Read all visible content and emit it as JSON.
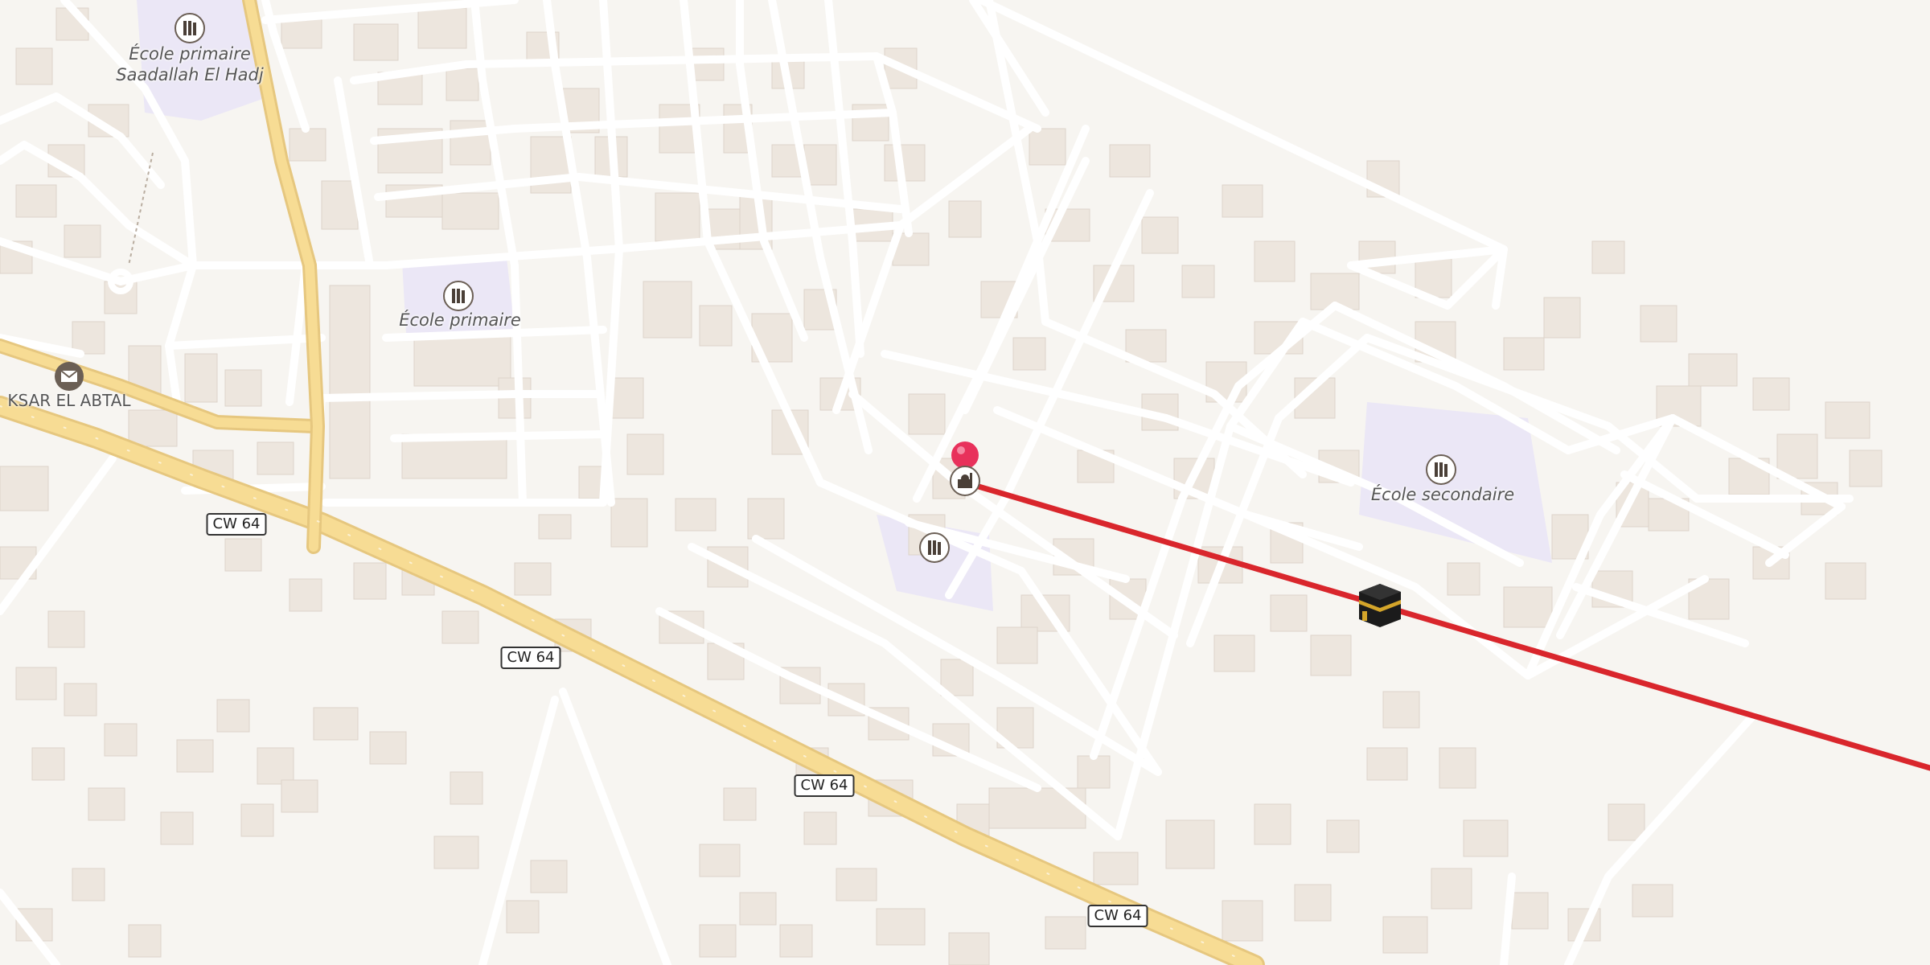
{
  "map": {
    "place_labels": {
      "ksar": "KSAR EL ABTAL"
    },
    "school_labels": {
      "school_1_line1": "École primaire",
      "school_1_line2": "Saadallah El Hadj",
      "school_2": "École primaire",
      "school_3": "École secondaire"
    },
    "road_shields": {
      "s1": "CW 64",
      "s2": "CW 64",
      "s3": "CW 64",
      "s4": "CW 64"
    },
    "icons": {
      "school": "school-icon",
      "mosque": "mosque-icon",
      "post_office": "envelope-icon",
      "kaaba": "kaaba-icon",
      "location_pin": "pin-icon"
    },
    "colors": {
      "background": "#f7f5f1",
      "building": "#ede6de",
      "road_major": "#f7dc94",
      "road_minor": "#ffffff",
      "school_area": "#ebe7f6",
      "qibla_line": "#d9262c",
      "pin": "#e8315b"
    }
  }
}
